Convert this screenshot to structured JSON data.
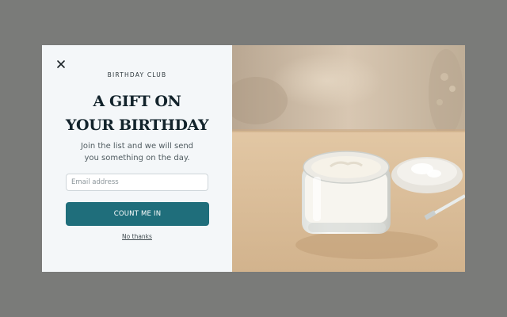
{
  "popup": {
    "kicker": "BIRTHDAY CLUB",
    "title_line1": "A GIFT ON",
    "title_line2": "YOUR BIRTHDAY",
    "subtitle_line1": "Join the list and we will send",
    "subtitle_line2": "you something on the day.",
    "email_placeholder": "Email address",
    "submit_label": "COUNT ME IN",
    "decline_label": "No thanks"
  },
  "icons": {
    "close": "close-icon"
  },
  "colors": {
    "overlay": "#7a7b79",
    "panel": "#f4f7f9",
    "accent": "#1f6e7b",
    "heading": "#12232b"
  }
}
